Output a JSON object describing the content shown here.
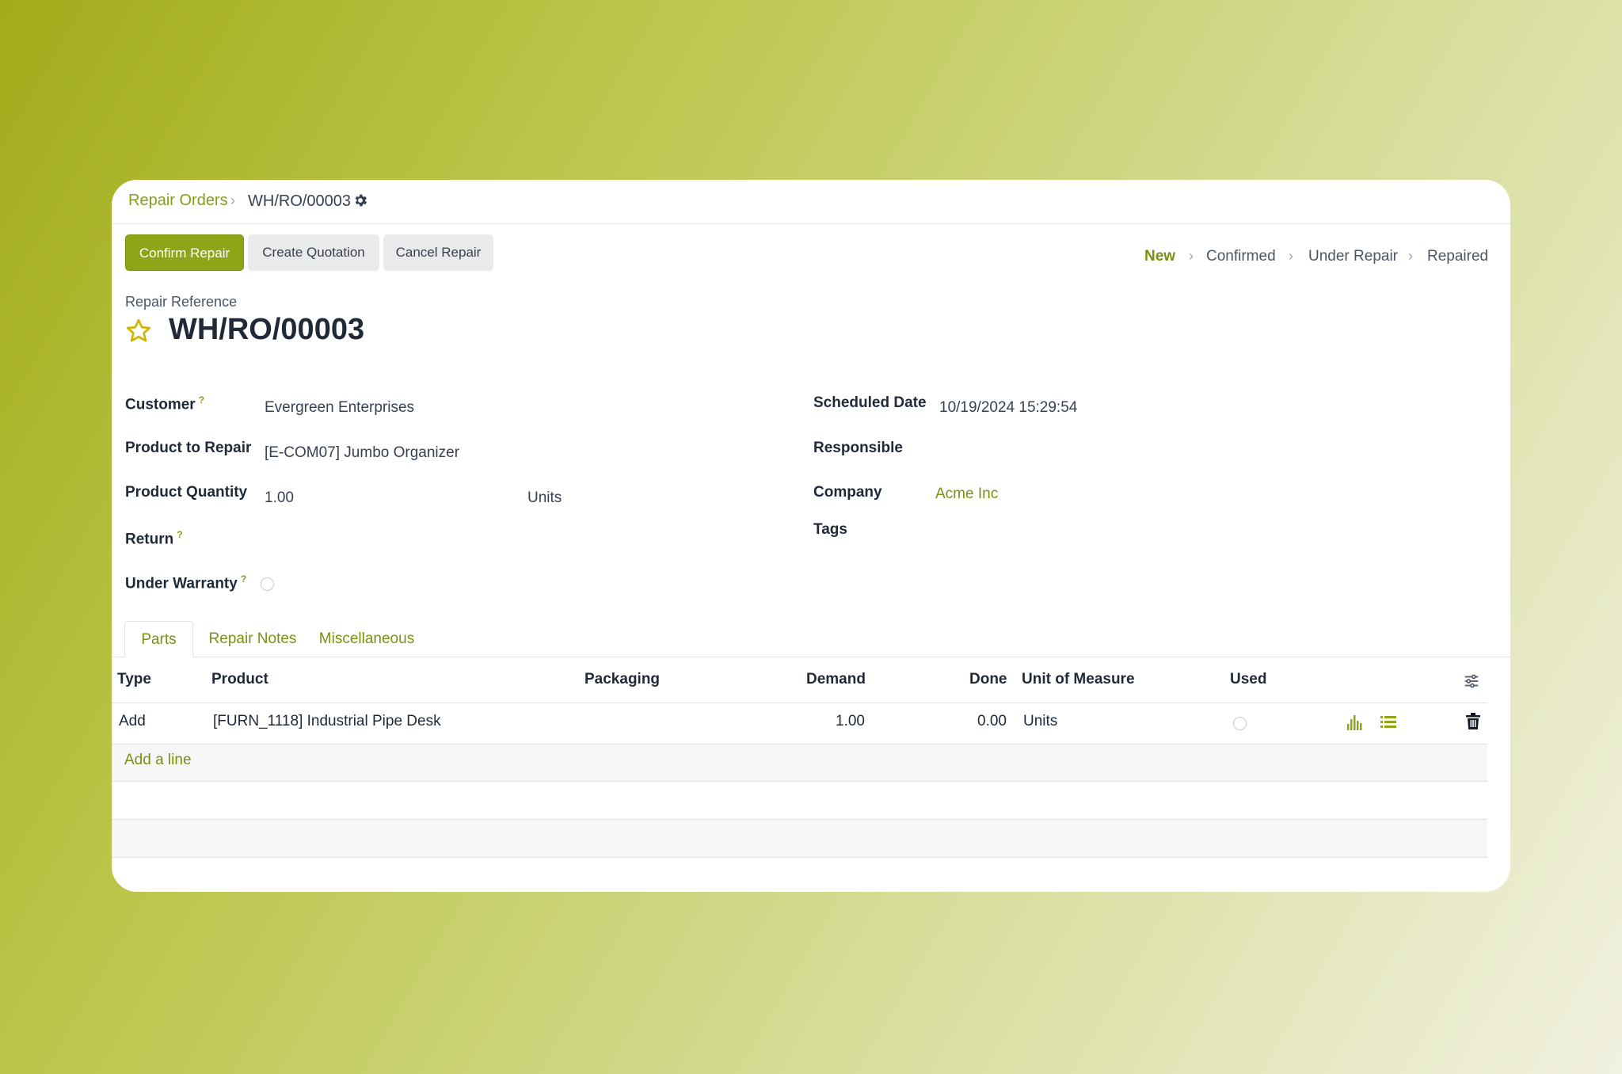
{
  "breadcrumb": {
    "parent": "Repair Orders",
    "separator": "›",
    "current": "WH/RO/00003"
  },
  "actions": {
    "confirm": "Confirm Repair",
    "quotation": "Create Quotation",
    "cancel": "Cancel Repair"
  },
  "statusbar": {
    "stages": [
      "New",
      "Confirmed",
      "Under Repair",
      "Repaired"
    ],
    "active": "New",
    "separator": "›"
  },
  "record": {
    "reference_label": "Repair Reference",
    "reference": "WH/RO/00003"
  },
  "form": {
    "left": {
      "customer": {
        "label": "Customer",
        "help": "?",
        "value": "Evergreen Enterprises"
      },
      "product": {
        "label": "Product to Repair",
        "value": "[E-COM07] Jumbo Organizer"
      },
      "quantity": {
        "label": "Product Quantity",
        "value": "1.00",
        "uom": "Units"
      },
      "return": {
        "label": "Return",
        "help": "?"
      },
      "warranty": {
        "label": "Under Warranty",
        "help": "?",
        "checked": false
      }
    },
    "right": {
      "scheduled": {
        "label": "Scheduled Date",
        "value": "10/19/2024 15:29:54"
      },
      "responsible": {
        "label": "Responsible"
      },
      "company": {
        "label": "Company",
        "value": "Acme Inc"
      },
      "tags": {
        "label": "Tags"
      }
    }
  },
  "tabs": [
    "Parts",
    "Repair Notes",
    "Miscellaneous"
  ],
  "parts_table": {
    "columns": [
      "Type",
      "Product",
      "Packaging",
      "Demand",
      "Done",
      "Unit of Measure",
      "Used"
    ],
    "rows": [
      {
        "type": "Add",
        "product": "[FURN_1118] Industrial Pipe Desk",
        "packaging": "",
        "demand": "1.00",
        "done": "0.00",
        "uom": "Units",
        "used": false
      }
    ],
    "add_line": "Add a line"
  },
  "colors": {
    "accent": "#8fa518",
    "link": "#7b8f12"
  },
  "icons": [
    "gear-icon",
    "star-icon",
    "forecast-chart-icon",
    "detailed-operations-icon",
    "trash-icon",
    "optional-columns-icon"
  ]
}
